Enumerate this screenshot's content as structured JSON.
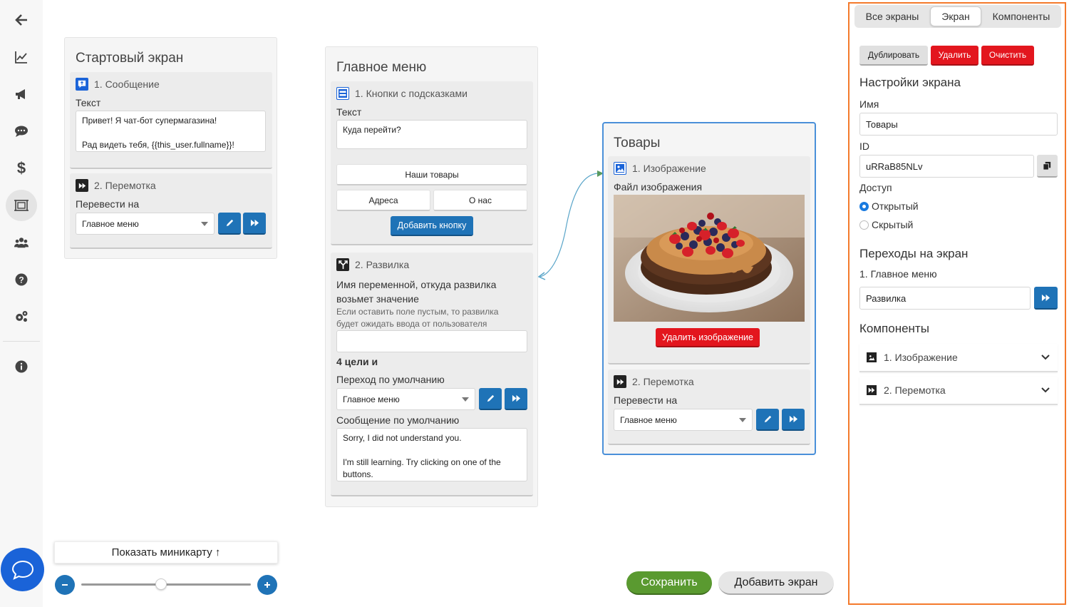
{
  "colors": {
    "accent": "#1f73b7",
    "danger": "#e3161e",
    "success": "#5a9a30",
    "panel_border": "#f47a2c",
    "selected_border": "#4a90d9",
    "chat": "#1a63d8"
  },
  "sidebar": {
    "items": [
      {
        "name": "back-arrow-icon"
      },
      {
        "name": "chart-icon"
      },
      {
        "name": "megaphone-icon"
      },
      {
        "name": "chat-icon"
      },
      {
        "name": "dollar-icon"
      },
      {
        "name": "screens-icon",
        "active": true
      },
      {
        "name": "users-icon"
      },
      {
        "name": "help-icon"
      },
      {
        "name": "settings-icon"
      },
      {
        "name": "info-icon"
      }
    ]
  },
  "screens": {
    "start": {
      "title": "Стартовый экран",
      "message": {
        "header": "1. Сообщение",
        "text_label": "Текст",
        "text_line1": "Привет! Я чат-бот супермагазина!",
        "text_line2": "Рад видеть тебя, {{this_user.fullname}}!"
      },
      "rewind": {
        "header": "2. Перемотка",
        "goto_label": "Перевести на",
        "goto_value": "Главное меню"
      }
    },
    "main": {
      "title": "Главное меню",
      "buttons_comp": {
        "header": "1. Кнопки с подсказками",
        "text_label": "Текст",
        "text_value": "Куда перейти?",
        "btn1": "Наши товары",
        "btn2": "Адреса",
        "btn3": "О нас",
        "add_button": "Добавить кнопку"
      },
      "fork": {
        "header": "2. Развилка",
        "var_label_1": "Имя переменной, откуда развилка",
        "var_label_2": "возьмет значение",
        "hint_1": "Если оставить поле пустым, то развилка",
        "hint_2": "будет ожидать ввода от пользователя",
        "var_value": "",
        "targets": "4 цели и",
        "default_label": "Переход по умолчанию",
        "default_value": "Главное меню",
        "msg_label": "Сообщение по умолчанию",
        "msg_line1": "Sorry, I did not understand you.",
        "msg_line2": "I'm still learning. Try clicking on one of the",
        "msg_line3": "buttons."
      }
    },
    "products": {
      "title": "Товары",
      "image": {
        "header": "1. Изображение",
        "file_label": "Файл изображения",
        "delete_button": "Удалить изображение"
      },
      "rewind": {
        "header": "2. Перемотка",
        "goto_label": "Перевести на",
        "goto_value": "Главное меню"
      }
    }
  },
  "panel": {
    "tabs": [
      "Все экраны",
      "Экран",
      "Компоненты"
    ],
    "active_tab": "Экран",
    "actions": {
      "duplicate": "Дублировать",
      "delete": "Удалить",
      "clear": "Очистить"
    },
    "settings_title": "Настройки экрана",
    "name_label": "Имя",
    "name_value": "Товары",
    "id_label": "ID",
    "id_value": "uRRaB85NLv",
    "access_label": "Доступ",
    "access_options": [
      "Открытый",
      "Скрытый"
    ],
    "access_selected": "Открытый",
    "transitions_title": "Переходы на экран",
    "transition_item": "1. Главное меню",
    "transition_value": "Развилка",
    "components_title": "Компоненты",
    "components": [
      "1. Изображение",
      "2. Перемотка"
    ]
  },
  "bottom": {
    "minimap": "Показать миникарту ↑",
    "zoom_level": 0.47,
    "save": "Сохранить",
    "add_screen": "Добавить экран"
  }
}
